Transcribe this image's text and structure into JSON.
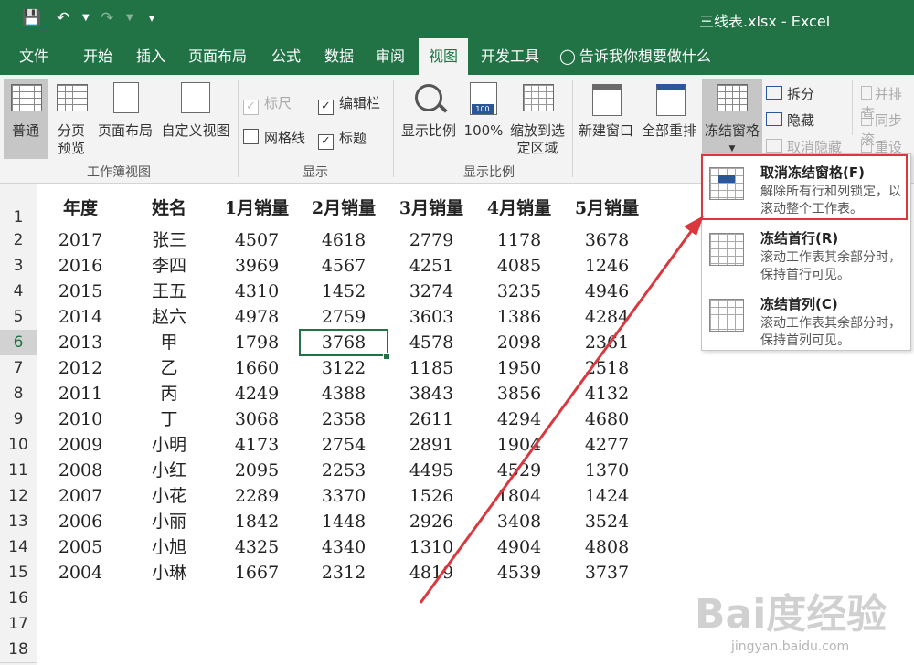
{
  "titlebar": {
    "save_icon": "save-icon",
    "undo_icon": "undo-icon",
    "redo_icon": "redo-icon",
    "customize_icon": "customize-quick-access-icon",
    "title": "三线表.xlsx  -  Excel"
  },
  "tabs": [
    "文件",
    "开始",
    "插入",
    "页面布局",
    "公式",
    "数据",
    "审阅",
    "视图",
    "开发工具"
  ],
  "tell_me": "告诉我你想要做什么",
  "ribbon": {
    "workbook_views": {
      "normal": "普通",
      "page_break": "分页预览",
      "page_layout": "页面布局",
      "custom": "自定义视图",
      "group": "工作簿视图"
    },
    "show": {
      "ruler": "标尺",
      "formula_bar": "编辑栏",
      "gridlines": "网格线",
      "headings": "标题",
      "group": "显示"
    },
    "zoom": {
      "zoom": "显示比例",
      "hundred": "100%",
      "zoom_selection": "缩放到选定区域",
      "hundred_icon_label": "100",
      "group": "显示比例"
    },
    "window": {
      "new_window": "新建窗口",
      "arrange_all": "全部重排",
      "freeze_panes": "冻结窗格",
      "split": "拆分",
      "hide": "隐藏",
      "unhide": "取消隐藏",
      "side_by_side": "并排查",
      "sync_scroll": "同步滚",
      "reset_pos": "重设窗"
    }
  },
  "freeze_menu": [
    {
      "title": "取消冻结窗格(F)",
      "desc": "解除所有行和列锁定，以滚动整个工作表。"
    },
    {
      "title": "冻结首行(R)",
      "desc": "滚动工作表其余部分时，保持首行可见。"
    },
    {
      "title": "冻结首列(C)",
      "desc": "滚动工作表其余部分时，保持首列可见。"
    }
  ],
  "sheet": {
    "headers": [
      "年度",
      "姓名",
      "1月销量",
      "2月销量",
      "3月销量",
      "4月销量",
      "5月销量"
    ],
    "rows": [
      [
        "2017",
        "张三",
        "4507",
        "4618",
        "2779",
        "1178",
        "3678"
      ],
      [
        "2016",
        "李四",
        "3969",
        "4567",
        "4251",
        "4085",
        "1246"
      ],
      [
        "2015",
        "王五",
        "4310",
        "1452",
        "3274",
        "3235",
        "4946"
      ],
      [
        "2014",
        "赵六",
        "4978",
        "2759",
        "3603",
        "1386",
        "4284"
      ],
      [
        "2013",
        "甲",
        "1798",
        "3768",
        "4578",
        "2098",
        "2361"
      ],
      [
        "2012",
        "乙",
        "1660",
        "3122",
        "1185",
        "1950",
        "2518"
      ],
      [
        "2011",
        "丙",
        "4249",
        "4388",
        "3843",
        "3856",
        "4132"
      ],
      [
        "2010",
        "丁",
        "3068",
        "2358",
        "2611",
        "4294",
        "4680"
      ],
      [
        "2009",
        "小明",
        "4173",
        "2754",
        "2891",
        "1904",
        "4277"
      ],
      [
        "2008",
        "小红",
        "2095",
        "2253",
        "4495",
        "4529",
        "1370"
      ],
      [
        "2007",
        "小花",
        "2289",
        "3370",
        "1526",
        "1804",
        "1424"
      ],
      [
        "2006",
        "小丽",
        "1842",
        "1448",
        "2926",
        "3408",
        "3524"
      ],
      [
        "2005",
        "小旭",
        "4325",
        "4340",
        "1310",
        "4904",
        "4808"
      ],
      [
        "2004",
        "小琳",
        "1667",
        "2312",
        "4819",
        "4539",
        "3737"
      ]
    ],
    "row_numbers": [
      "1",
      "2",
      "3",
      "4",
      "5",
      "6",
      "7",
      "8",
      "9",
      "10",
      "11",
      "12",
      "13",
      "14",
      "15",
      "16",
      "17",
      "18"
    ]
  },
  "watermark": {
    "logo": "Bai度经验",
    "url": "jingyan.baidu.com"
  },
  "colors": {
    "excel_green": "#217346",
    "annotation_red": "#d9393e",
    "selection": "#217346"
  }
}
